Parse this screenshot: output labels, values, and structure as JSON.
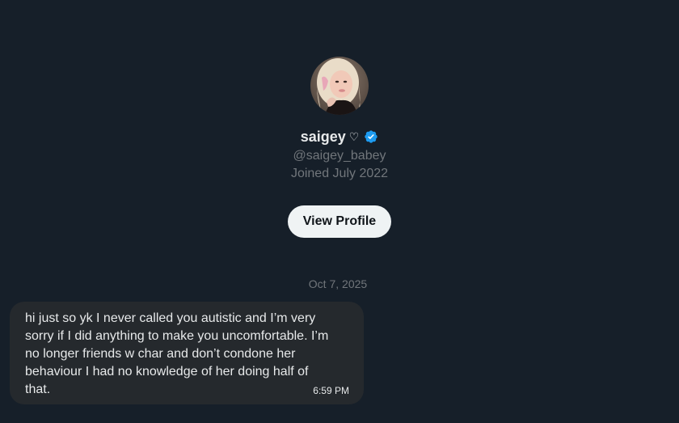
{
  "profile": {
    "display_name": "saigey",
    "name_symbol": "♡",
    "handle": "@saigey_babey",
    "joined": "Joined July 2022",
    "view_profile_label": "View Profile"
  },
  "conversation": {
    "date_separator": "Oct 7, 2025",
    "messages": [
      {
        "text": "hi just so yk I never called you autistic and I’m very\nsorry if I did anything to make you uncomfortable. I’m\nno longer friends w char and don’t condone her\nbehaviour I had no knowledge of her doing half of\nthat.",
        "time": "6:59 PM"
      }
    ]
  },
  "colors": {
    "background": "#161f29",
    "bubble": "#25292d",
    "verified": "#1d9bf0",
    "muted_text": "#71767b",
    "button_bg": "#eff3f4"
  },
  "icons": {
    "verified": "verified-badge-icon",
    "avatar": "profile-photo"
  }
}
